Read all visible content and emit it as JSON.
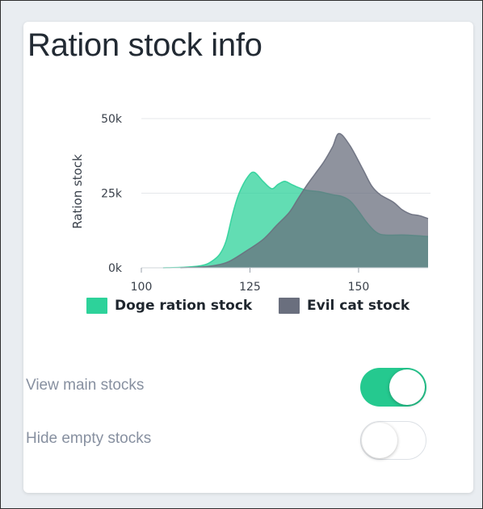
{
  "card": {
    "title": "Ration stock info"
  },
  "chart_data": {
    "type": "area",
    "ylabel": "Ration stock",
    "xlabel": "",
    "xlim": [
      100,
      166
    ],
    "ylim": [
      0,
      50000
    ],
    "x_ticks": [
      "100",
      "125",
      "150"
    ],
    "y_ticks": [
      "0k",
      "25k",
      "50k"
    ],
    "x_tick_values": [
      100,
      125,
      150
    ],
    "y_tick_values": [
      0,
      25000,
      50000
    ],
    "grid": true,
    "legend_position": "bottom",
    "series": [
      {
        "name": "Doge ration stock",
        "color": "#2dd29a",
        "points": [
          [
            105,
            0
          ],
          [
            110,
            200
          ],
          [
            114,
            800
          ],
          [
            116,
            2000
          ],
          [
            118,
            4500
          ],
          [
            119.5,
            9000
          ],
          [
            121,
            18000
          ],
          [
            122.5,
            25000
          ],
          [
            124.5,
            30500
          ],
          [
            126,
            32000
          ],
          [
            128,
            29000
          ],
          [
            130,
            26500
          ],
          [
            131.5,
            28000
          ],
          [
            133,
            29000
          ],
          [
            134.5,
            28000
          ],
          [
            136,
            27000
          ],
          [
            138,
            26000
          ],
          [
            141,
            25500
          ],
          [
            144,
            24500
          ],
          [
            146,
            24000
          ],
          [
            148,
            22500
          ],
          [
            150,
            19000
          ],
          [
            152,
            15000
          ],
          [
            154,
            12000
          ],
          [
            156,
            11000
          ],
          [
            160,
            11000
          ],
          [
            163,
            10800
          ],
          [
            166,
            10500
          ]
        ]
      },
      {
        "name": "Evil cat stock",
        "color": "#6a6f7e",
        "points": [
          [
            109,
            0
          ],
          [
            113,
            200
          ],
          [
            117,
            800
          ],
          [
            120,
            2000
          ],
          [
            124,
            5500
          ],
          [
            128,
            9500
          ],
          [
            131,
            14000
          ],
          [
            134,
            18500
          ],
          [
            136,
            23000
          ],
          [
            138,
            27500
          ],
          [
            140,
            31500
          ],
          [
            142,
            35500
          ],
          [
            144,
            40500
          ],
          [
            145.5,
            45000
          ],
          [
            148,
            41000
          ],
          [
            151,
            33000
          ],
          [
            153,
            27500
          ],
          [
            155,
            24500
          ],
          [
            158,
            22000
          ],
          [
            160,
            19500
          ],
          [
            162,
            18000
          ],
          [
            164,
            17500
          ],
          [
            166,
            16500
          ]
        ]
      }
    ]
  },
  "toggles": [
    {
      "label": "View main stocks",
      "on": true
    },
    {
      "label": "Hide empty stocks",
      "on": false
    }
  ]
}
